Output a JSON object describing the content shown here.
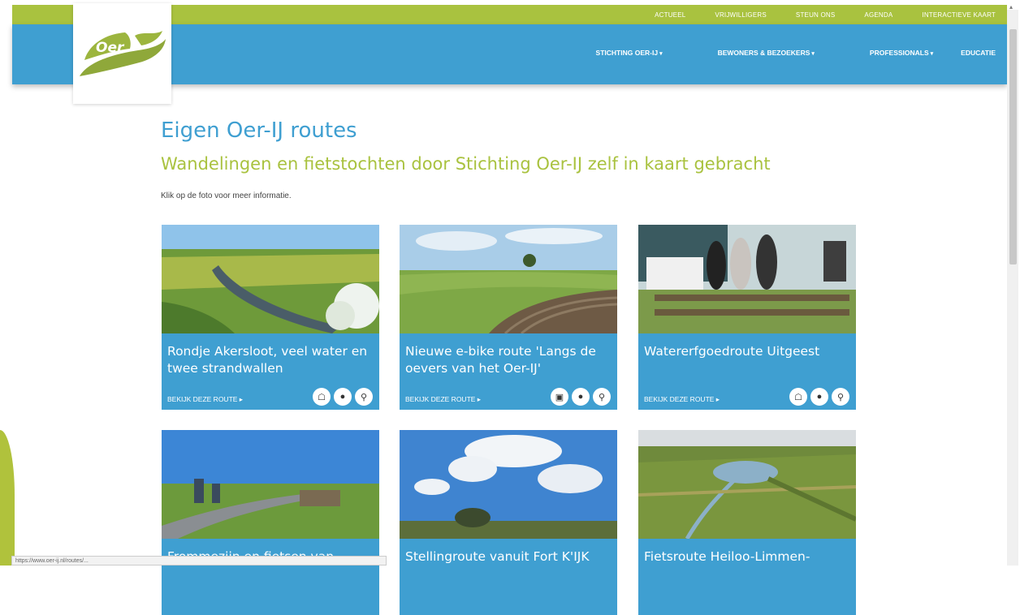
{
  "topnav": [
    "Actueel",
    "Vrijwilligers",
    "Steun ons",
    "Agenda",
    "Interactieve kaart"
  ],
  "mainnav": [
    {
      "label": "Stichting Oer-IJ",
      "caret": "▾"
    },
    {
      "label": "Bewoners & bezoekers",
      "caret": "▾"
    },
    {
      "label": "Professionals",
      "caret": "▾"
    },
    {
      "label": "Educatie",
      "caret": ""
    }
  ],
  "logo": {
    "text": "Oer"
  },
  "page": {
    "title": "Eigen Oer-IJ routes",
    "subtitle": "Wandelingen en fietstochten door Stichting Oer-IJ zelf in kaart gebracht",
    "intro": "Klik op de foto voor meer informatie."
  },
  "cards": [
    {
      "title": "Rondje Akersloot, veel water en twee strandwallen",
      "more": "Bekijk deze route ▸"
    },
    {
      "title": "Nieuwe e-bike route 'Langs de oevers van het Oer-IJ'",
      "more": "Bekijk deze route ▸"
    },
    {
      "title": "Watererfgoedroute Uitgeest",
      "more": "Bekijk deze route ▸"
    },
    {
      "title": "Frommezijn en fietsen van",
      "more": ""
    },
    {
      "title": "Stellingroute vanuit Fort K'IJK",
      "more": ""
    },
    {
      "title": "Fietsroute Heiloo-Limmen-",
      "more": ""
    }
  ],
  "colors": {
    "green": "#a9c23f",
    "blue": "#3f9fd1"
  },
  "status": "https://www.oer-ij.nl/routes/..."
}
